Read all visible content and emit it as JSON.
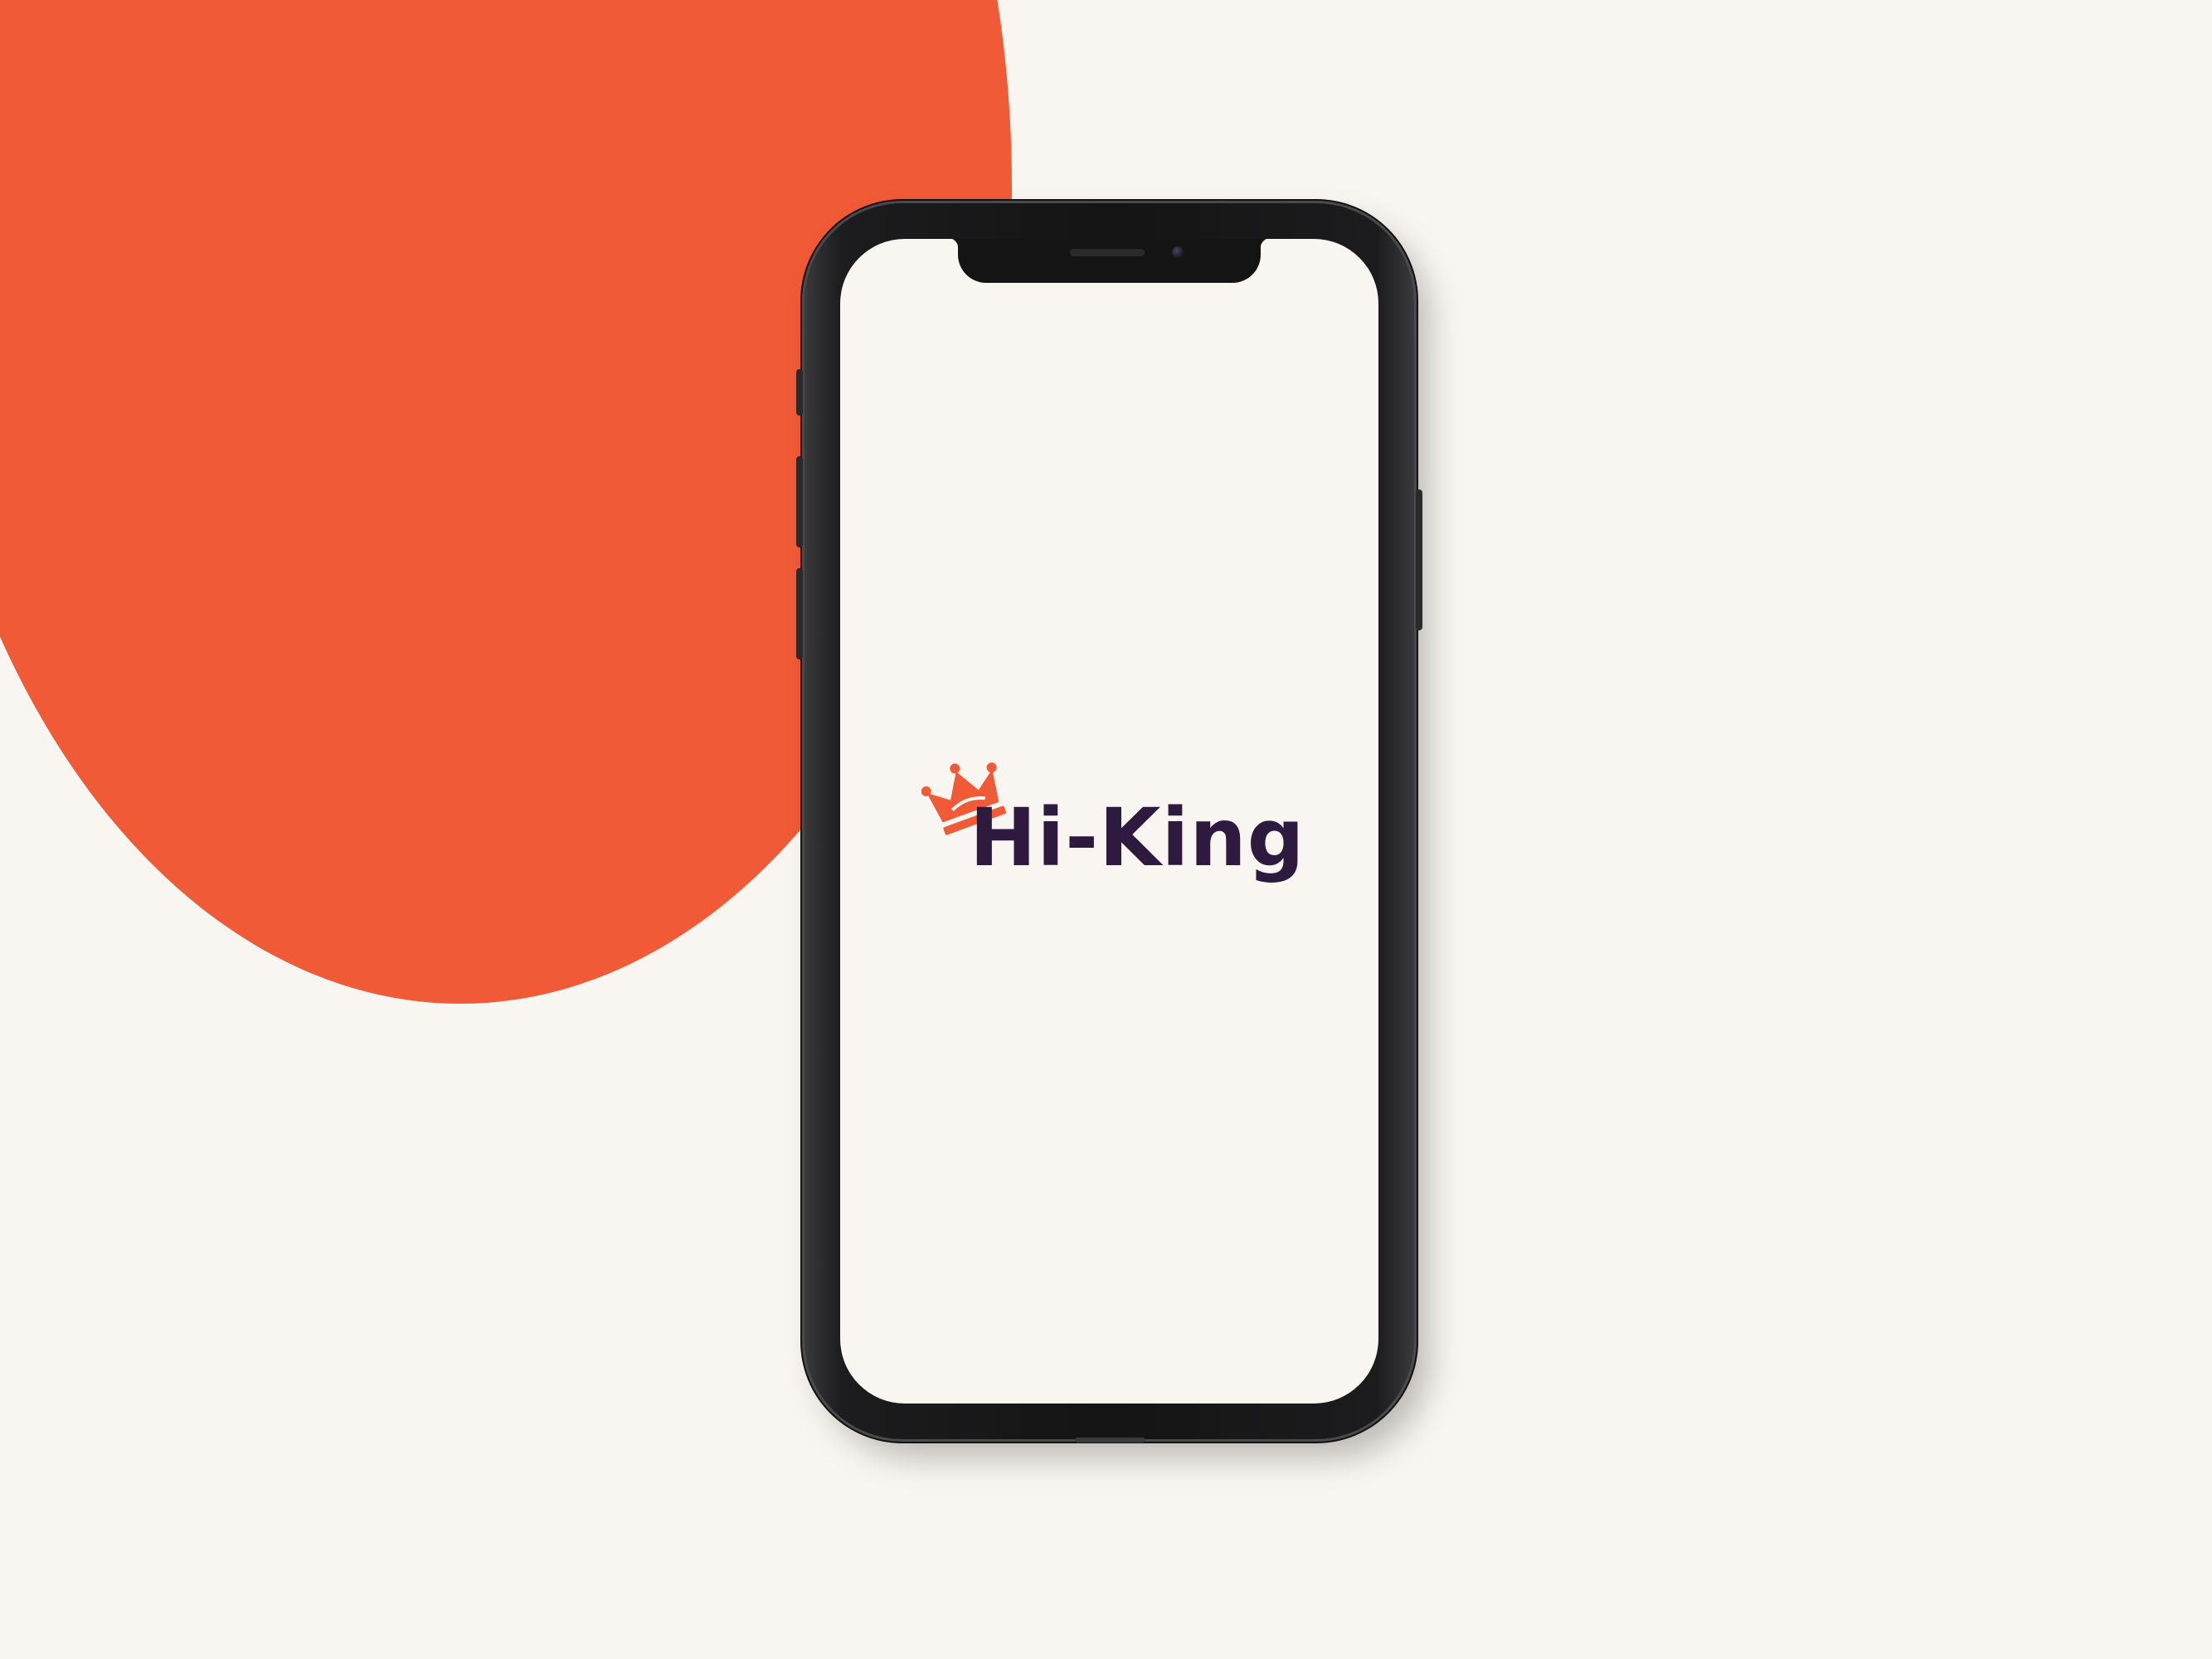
{
  "colors": {
    "background": "#f9f6f1",
    "accent": "#f15a36",
    "brand_text": "#2e1a3f",
    "screen": "#f9f6f1"
  },
  "app": {
    "logo_text": "Hi-King",
    "logo_icon": "crown-icon"
  }
}
